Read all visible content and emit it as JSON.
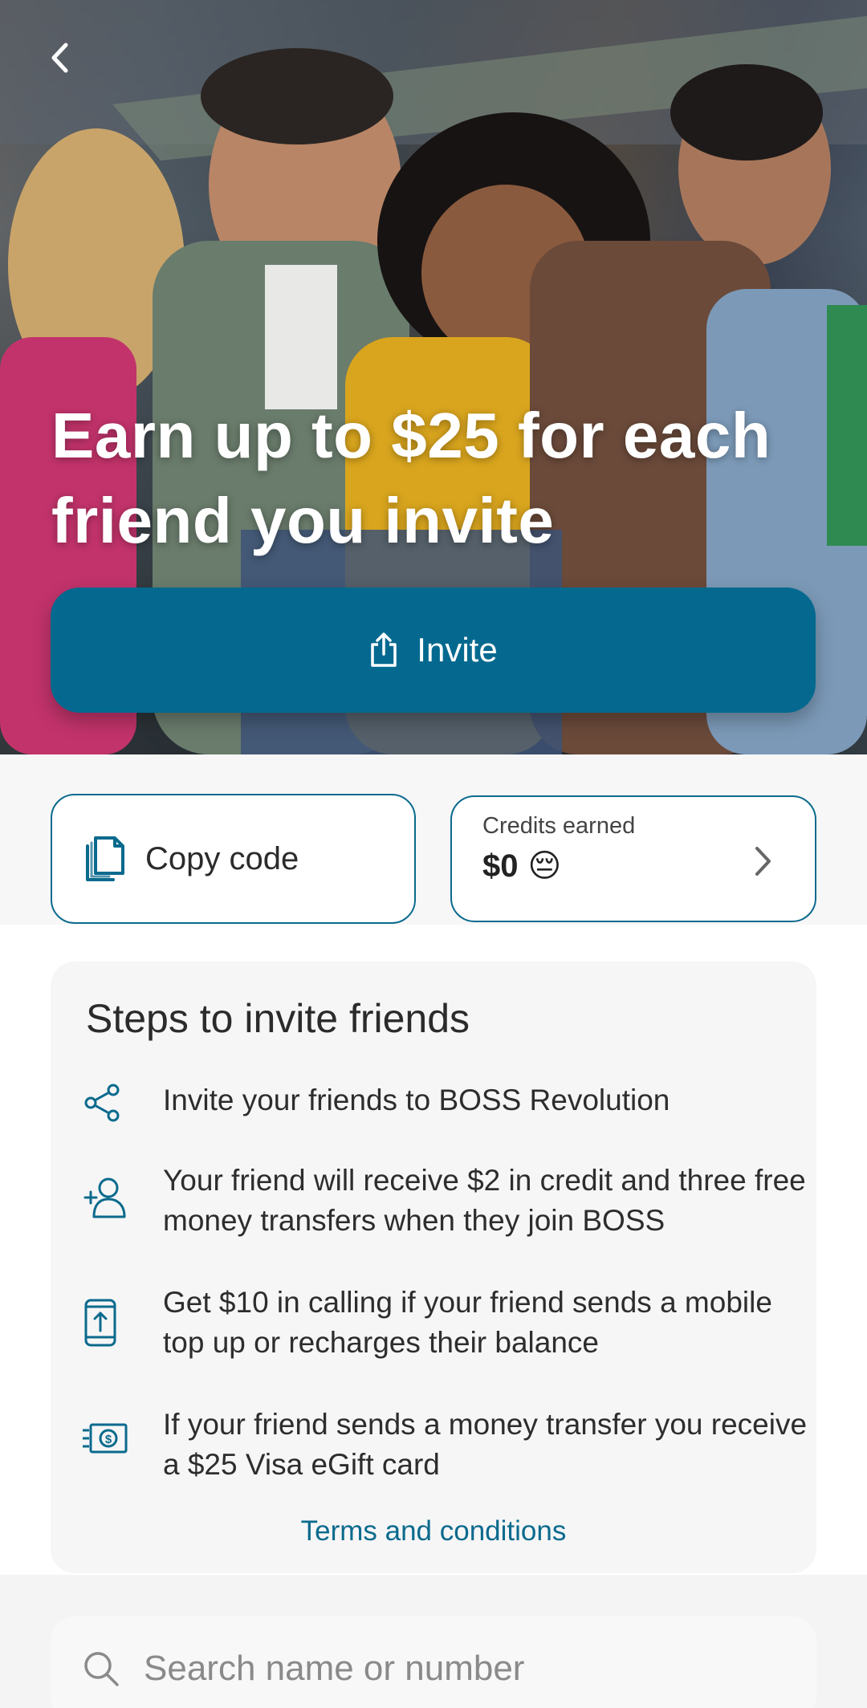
{
  "hero": {
    "title": "Earn up to $25 for each friend you invite",
    "invite_label": "Invite",
    "background_icon": "people-photo"
  },
  "actions": {
    "copy_code_label": "Copy code",
    "credits_caption": "Credits earned",
    "credits_amount": "$0",
    "credits_emoji": "😔"
  },
  "steps": {
    "title": "Steps to invite friends",
    "items": [
      {
        "icon": "share-icon",
        "text": "Invite your friends to BOSS Revolution"
      },
      {
        "icon": "add-person-icon",
        "text": "Your friend will receive $2 in credit and three free money transfers when they join BOSS"
      },
      {
        "icon": "mobile-topup-icon",
        "text": "Get $10 in calling if your friend sends a mobile top up or recharges their balance"
      },
      {
        "icon": "money-icon",
        "text": "If your friend sends a money transfer you receive a $25 Visa eGift card"
      }
    ],
    "terms_label": "Terms and conditions"
  },
  "search": {
    "placeholder": "Search name or number"
  },
  "colors": {
    "accent": "#05698f",
    "link": "#0b6a8d",
    "card_bg": "#f6f6f6"
  }
}
